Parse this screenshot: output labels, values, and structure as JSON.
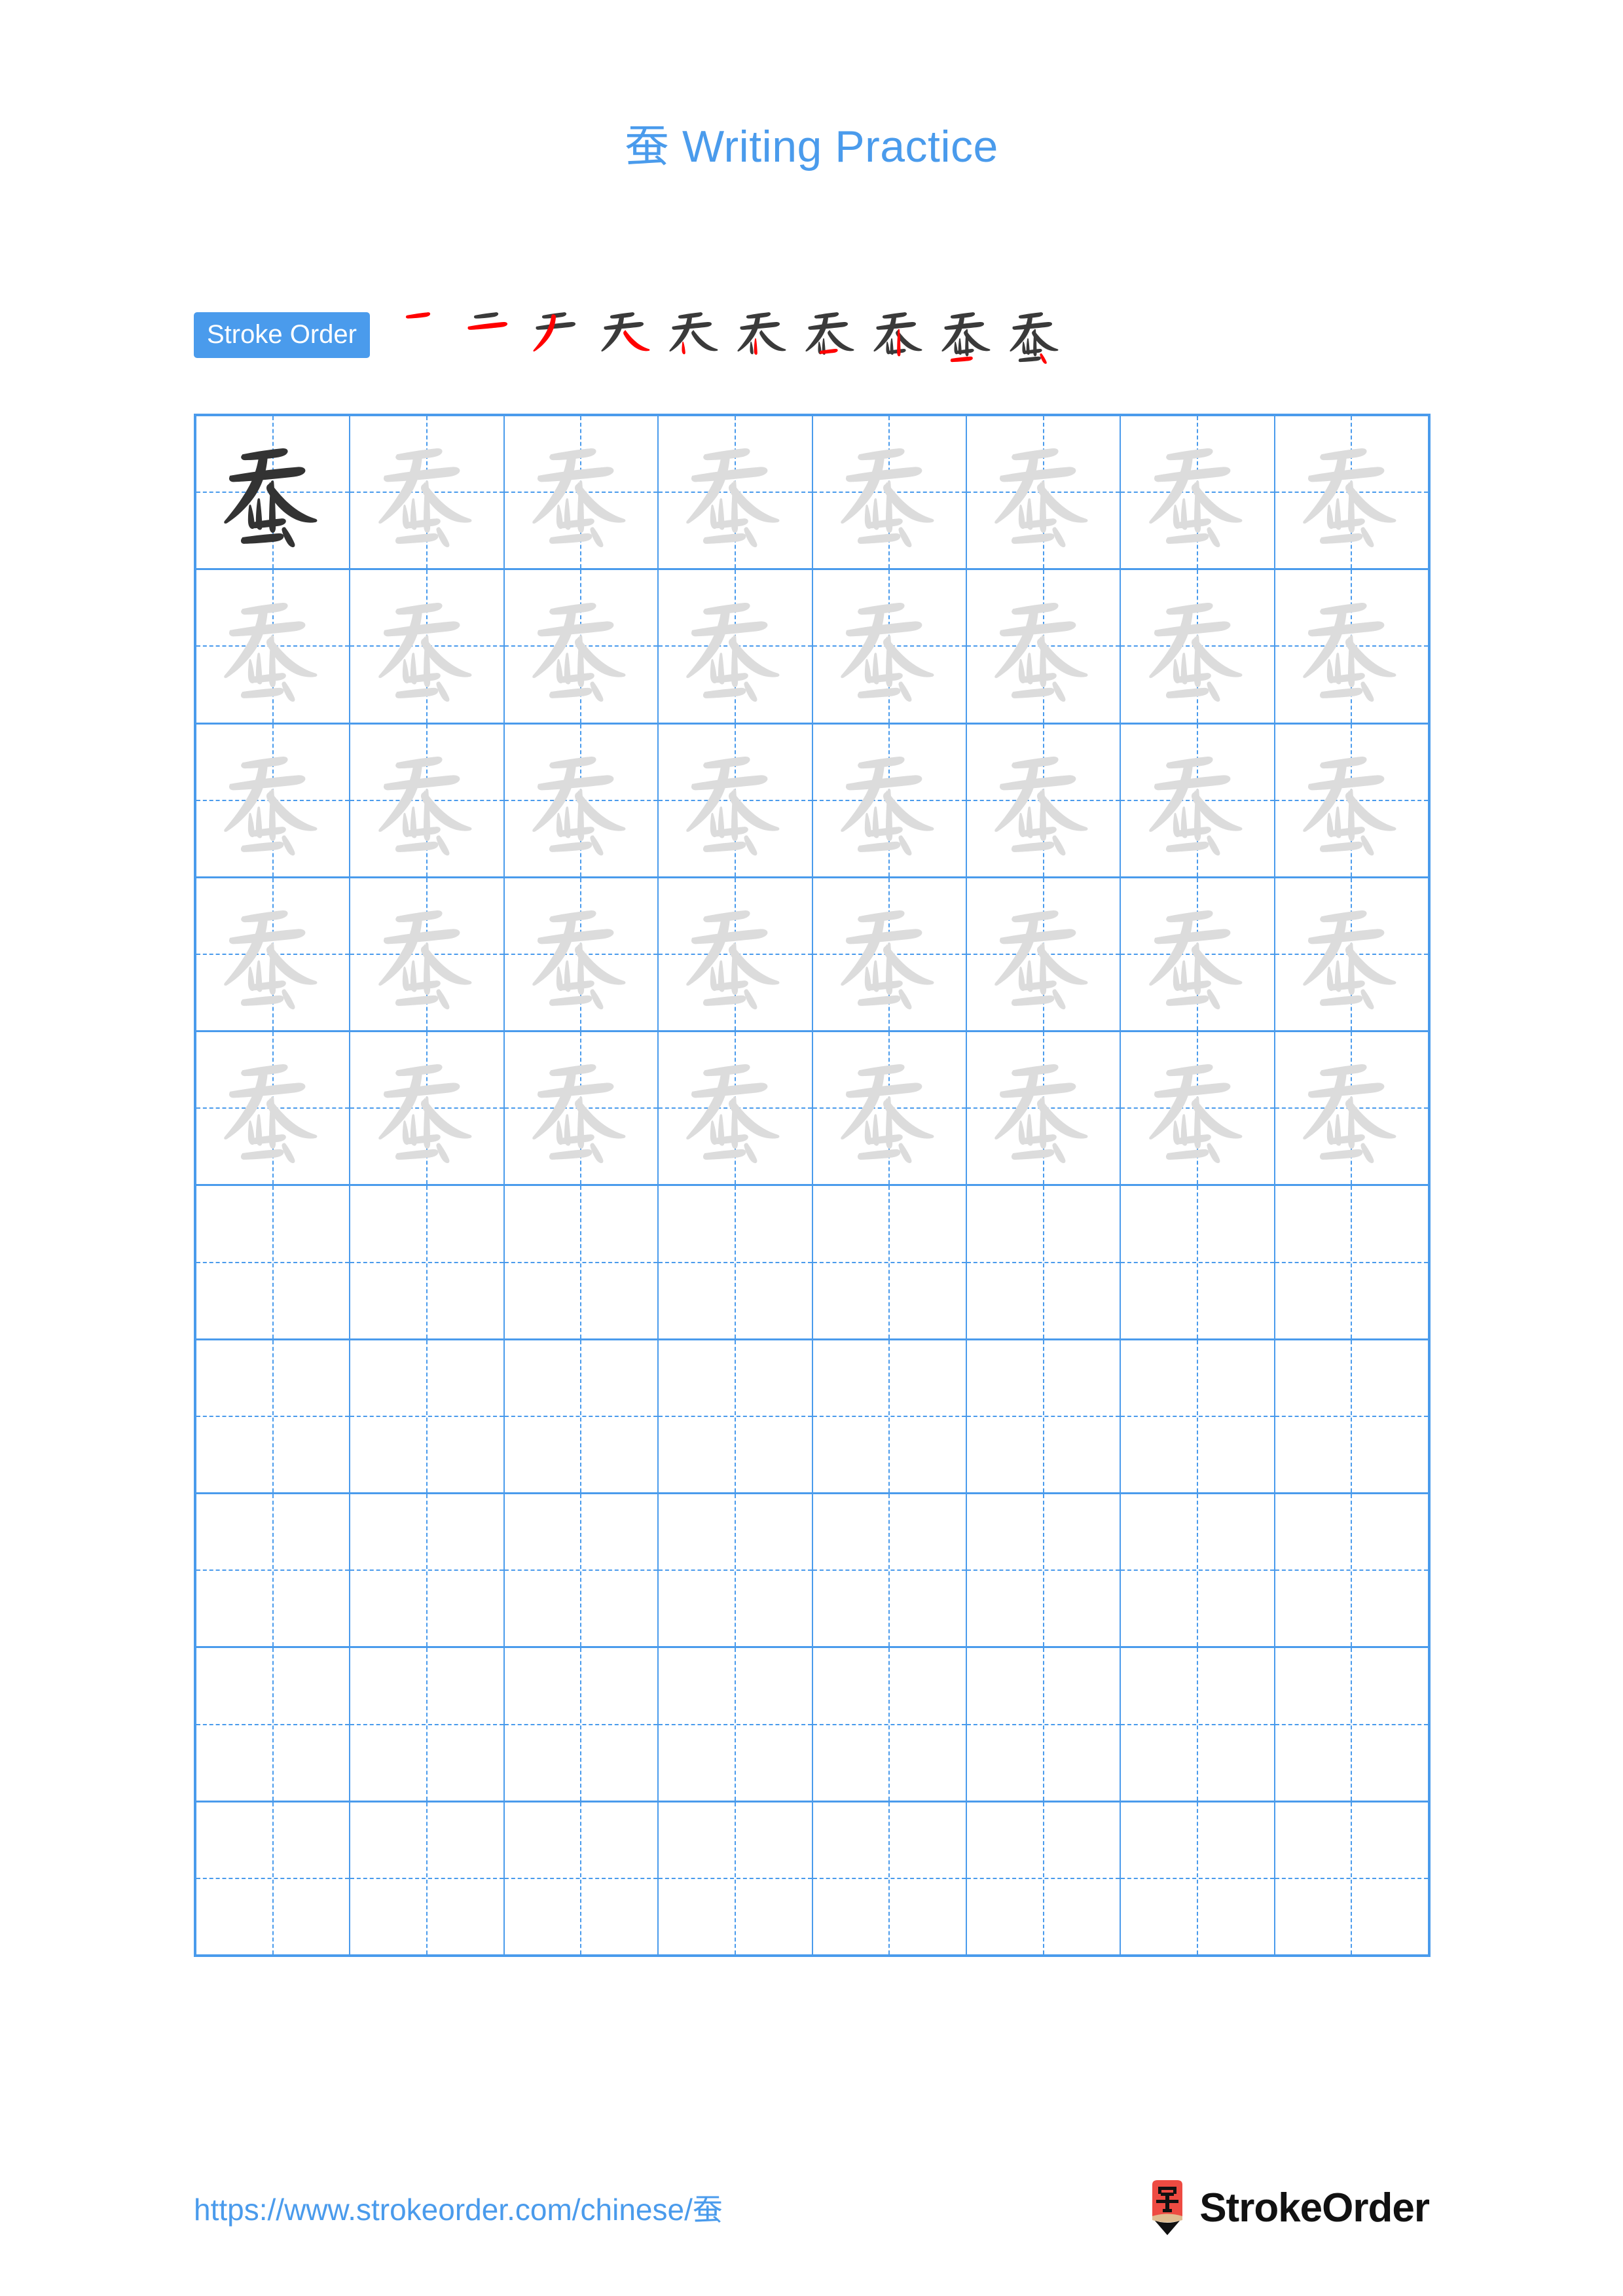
{
  "page": {
    "title": "蚕 Writing Practice",
    "character": "蚕",
    "background_color": "#ffffff",
    "accent_color": "#4a9bec",
    "guide_char_color": "#dcdcdc",
    "example_char_color": "#333333",
    "new_stroke_color": "#ff0000",
    "prev_stroke_color": "#3a3a3a"
  },
  "stroke_order": {
    "badge_label": "Stroke Order",
    "total_strokes": 10,
    "steps": [
      {
        "index": 1,
        "new_stroke_count": 1,
        "cumulative_strokes": 1
      },
      {
        "index": 2,
        "new_stroke_count": 1,
        "cumulative_strokes": 2
      },
      {
        "index": 3,
        "new_stroke_count": 1,
        "cumulative_strokes": 3
      },
      {
        "index": 4,
        "new_stroke_count": 1,
        "cumulative_strokes": 4
      },
      {
        "index": 5,
        "new_stroke_count": 1,
        "cumulative_strokes": 5
      },
      {
        "index": 6,
        "new_stroke_count": 1,
        "cumulative_strokes": 6
      },
      {
        "index": 7,
        "new_stroke_count": 1,
        "cumulative_strokes": 7
      },
      {
        "index": 8,
        "new_stroke_count": 1,
        "cumulative_strokes": 8
      },
      {
        "index": 9,
        "new_stroke_count": 1,
        "cumulative_strokes": 9
      },
      {
        "index": 10,
        "new_stroke_count": 1,
        "cumulative_strokes": 10
      }
    ]
  },
  "practice_grid": {
    "columns": 8,
    "rows": 10,
    "filled_rows": 5,
    "empty_rows": 5,
    "cells": [
      [
        "dark",
        "light",
        "light",
        "light",
        "light",
        "light",
        "light",
        "light"
      ],
      [
        "light",
        "light",
        "light",
        "light",
        "light",
        "light",
        "light",
        "light"
      ],
      [
        "light",
        "light",
        "light",
        "light",
        "light",
        "light",
        "light",
        "light"
      ],
      [
        "light",
        "light",
        "light",
        "light",
        "light",
        "light",
        "light",
        "light"
      ],
      [
        "light",
        "light",
        "light",
        "light",
        "light",
        "light",
        "light",
        "light"
      ],
      [
        "empty",
        "empty",
        "empty",
        "empty",
        "empty",
        "empty",
        "empty",
        "empty"
      ],
      [
        "empty",
        "empty",
        "empty",
        "empty",
        "empty",
        "empty",
        "empty",
        "empty"
      ],
      [
        "empty",
        "empty",
        "empty",
        "empty",
        "empty",
        "empty",
        "empty",
        "empty"
      ],
      [
        "empty",
        "empty",
        "empty",
        "empty",
        "empty",
        "empty",
        "empty",
        "empty"
      ],
      [
        "empty",
        "empty",
        "empty",
        "empty",
        "empty",
        "empty",
        "empty",
        "empty"
      ]
    ]
  },
  "footer": {
    "url": "https://www.strokeorder.com/chinese/蚕",
    "logo_text": "StrokeOrder",
    "logo_glyph": "字",
    "logo_body_color": "#ee4b42",
    "logo_wood_color": "#e0bc90",
    "logo_tip_color": "#111111"
  }
}
